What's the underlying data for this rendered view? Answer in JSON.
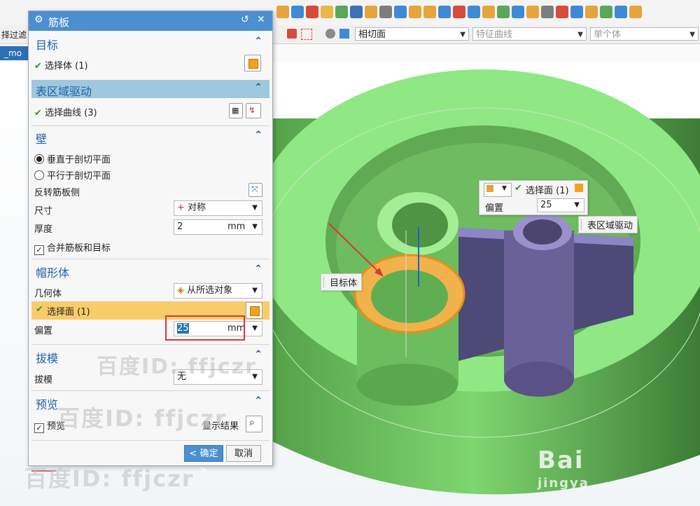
{
  "toolbar": {
    "filter_label": "择过滤",
    "face_rule": "相切面",
    "curve_rule": "特征曲线",
    "body_rule": "单个体"
  },
  "tab": {
    "label": "_mo"
  },
  "dialog": {
    "title": "筋板",
    "sections": {
      "target": {
        "title": "目标",
        "select_body": "选择体 (1)"
      },
      "surface_drive": {
        "title": "表区域驱动",
        "select_curve": "选择曲线 (3)"
      },
      "wall": {
        "title": "壁",
        "opt_perpendicular": "垂直于剖切平面",
        "opt_parallel": "平行于剖切平面",
        "reverse_side": "反转筋板侧",
        "size_label": "尺寸",
        "size_value": "对称",
        "thickness_label": "厚度",
        "thickness_value": "2",
        "thickness_unit": "mm",
        "merge_label": "合并筋板和目标"
      },
      "cap": {
        "title": "帽形体",
        "geometry_label": "几何体",
        "geometry_value": "从所选对象",
        "select_face": "选择面 (1)",
        "offset_label": "偏置",
        "offset_value": "25",
        "offset_unit": "mm"
      },
      "draft": {
        "title": "拔模",
        "draft_label": "拔模",
        "draft_value": "无"
      },
      "preview": {
        "title": "预览",
        "preview_label": "预览",
        "show_result": "显示结果"
      }
    },
    "ok_label": "< 确定 >",
    "cancel_label": "取消"
  },
  "popup": {
    "select_face": "选择面 (1)",
    "offset_label": "偏置",
    "offset_value": "25"
  },
  "labels": {
    "target_body": "目标体",
    "surface_drive": "表区域驱动"
  },
  "watermarks": [
    "百度ID: ffjczr",
    "百度ID: ffjczr",
    "百度ID: ffjczr",
    "Bai",
    "jingya"
  ],
  "colors": {
    "dialog_title": "#4b8fd1",
    "part_green": "#86e07a",
    "highlight": "#f9cc6a",
    "arrow_red": "#d73838"
  }
}
